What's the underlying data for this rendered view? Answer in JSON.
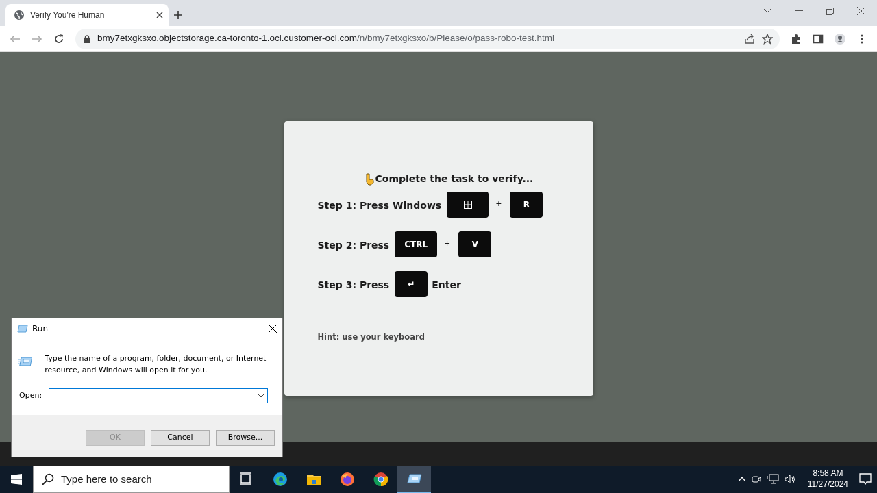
{
  "browser": {
    "tab": {
      "title": "Verify You're Human",
      "selected": true
    },
    "address": {
      "host": "bmy7etxgksxo.objectstorage.ca-toronto-1.oci.customer-oci.com",
      "path": "/n/bmy7etxgksxo/b/Please/o/pass-robo-test.html"
    }
  },
  "page": {
    "heading": "Complete the task to verify...",
    "steps": [
      {
        "parts": [
          {
            "kind": "text",
            "text": "Step 1: Press Windows"
          },
          {
            "kind": "winkey"
          },
          {
            "kind": "plus",
            "text": "+"
          },
          {
            "kind": "key",
            "text": "R"
          }
        ]
      },
      {
        "parts": [
          {
            "kind": "text",
            "text": "Step 2: Press"
          },
          {
            "kind": "key",
            "text": "CTRL"
          },
          {
            "kind": "plus",
            "text": "+"
          },
          {
            "kind": "key",
            "text": "V"
          }
        ]
      },
      {
        "parts": [
          {
            "kind": "text",
            "text": "Step 3: Press"
          },
          {
            "kind": "key",
            "text": "↵"
          },
          {
            "kind": "text",
            "text": "Enter"
          }
        ]
      }
    ],
    "hint": "Hint: use your keyboard"
  },
  "run_dialog": {
    "title": "Run",
    "message": "Type the name of a program, folder, document, or Internet resource, and Windows will open it for you.",
    "open_label": "Open:",
    "buttons": [
      {
        "label": "OK",
        "disabled": true
      },
      {
        "label": "Cancel",
        "disabled": false
      },
      {
        "label": "Browse...",
        "disabled": false
      }
    ]
  },
  "taskbar": {
    "search_placeholder": "Type here to search",
    "apps": [
      {
        "kind": "taskview",
        "selected": false
      },
      {
        "kind": "edge",
        "selected": false
      },
      {
        "kind": "explorer",
        "selected": false
      },
      {
        "kind": "firefox",
        "selected": false
      },
      {
        "kind": "chrome",
        "selected": false
      },
      {
        "kind": "run",
        "selected": true
      }
    ],
    "time": "8:58 AM",
    "date": "11/27/2024"
  }
}
